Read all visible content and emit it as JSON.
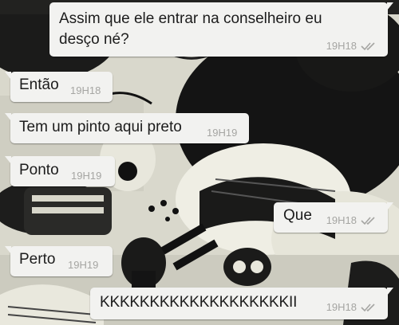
{
  "conversation": {
    "messages": [
      {
        "direction": "out",
        "text_line1": "Assim que ele entrar na conselheiro eu",
        "text_line2": "desço né?",
        "time": "19H18",
        "ticks": "double-check-icon"
      },
      {
        "direction": "in",
        "text": "Então",
        "time": "19H18"
      },
      {
        "direction": "in",
        "text": "Tem um pinto aqui preto",
        "time": "19H19"
      },
      {
        "direction": "in",
        "text": "Ponto",
        "time": "19H19"
      },
      {
        "direction": "out",
        "text": "Que",
        "time": "19H18",
        "ticks": "double-check-icon"
      },
      {
        "direction": "in",
        "text": "Perto",
        "time": "19H19"
      },
      {
        "direction": "out",
        "text": "KKKKKKKKKKKKKKKKKKKII",
        "time": "19H18",
        "ticks": "double-check-icon"
      }
    ]
  },
  "colors": {
    "bubble": "#f2f2f0",
    "text": "#1c1c1c",
    "meta": "#a5a5a2",
    "wallpaper_dark": "#141414",
    "wallpaper_light": "#e3e2d6"
  }
}
